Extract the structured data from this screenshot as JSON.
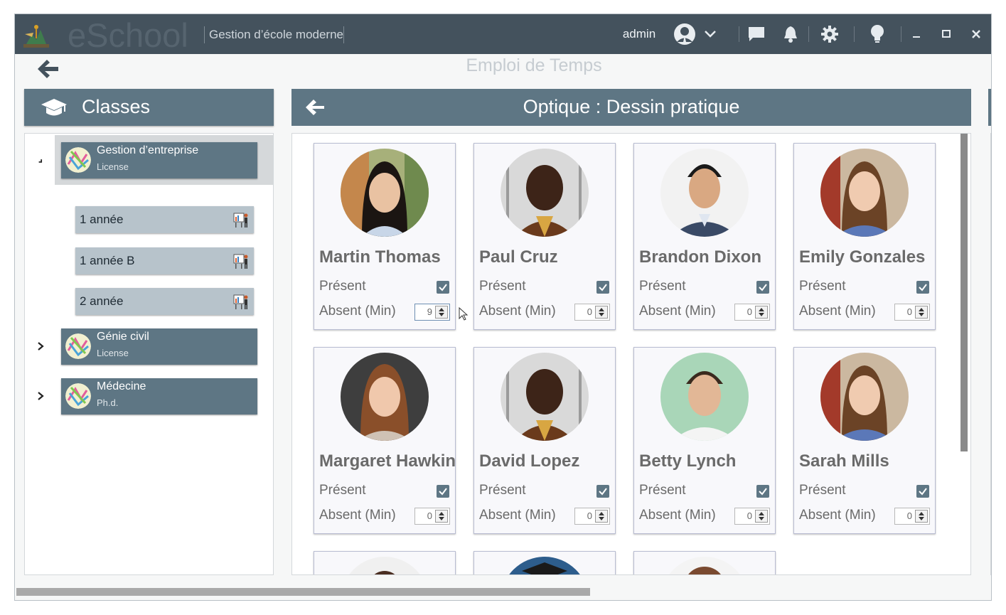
{
  "app": {
    "brand": "eSchool",
    "subtitle": "Gestion d’école moderne",
    "user": "admin",
    "page_title": "Emploi de Temps"
  },
  "left": {
    "header": "Classes",
    "classes": [
      {
        "name": "Gestion d’entreprise",
        "level": "License",
        "expanded": true,
        "years": [
          "1  année",
          "1  année B",
          "2  année"
        ]
      },
      {
        "name": "Génie civil",
        "level": "License",
        "expanded": false
      },
      {
        "name": "Médecine",
        "level": "Ph.d.",
        "expanded": false
      }
    ]
  },
  "right": {
    "header": "Optique : Dessin pratique",
    "present_label": "Présent",
    "absent_label": "Absent (Min)",
    "students": [
      {
        "name": "Martin Thomas",
        "present": true,
        "absent_min": "9"
      },
      {
        "name": "Paul Cruz",
        "present": true,
        "absent_min": "0"
      },
      {
        "name": "Brandon Dixon",
        "present": true,
        "absent_min": "0"
      },
      {
        "name": "Emily Gonzales",
        "present": true,
        "absent_min": "0"
      },
      {
        "name": "Margaret Hawkins",
        "present": true,
        "absent_min": "0"
      },
      {
        "name": "David Lopez",
        "present": true,
        "absent_min": "0"
      },
      {
        "name": "Betty Lynch",
        "present": true,
        "absent_min": "0"
      },
      {
        "name": "Sarah Mills",
        "present": true,
        "absent_min": "0"
      }
    ]
  },
  "colors": {
    "titlebar": "#44525d",
    "accent": "#5e7684",
    "year_card": "#b7c3cb"
  }
}
